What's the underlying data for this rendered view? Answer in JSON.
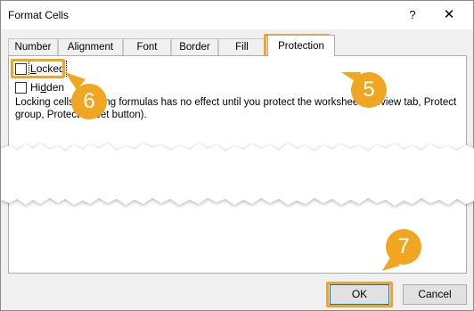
{
  "window": {
    "title": "Format Cells",
    "help_glyph": "?",
    "close_glyph": "✕"
  },
  "tabs": [
    {
      "label": "Number"
    },
    {
      "label": "Alignment"
    },
    {
      "label": "Font"
    },
    {
      "label": "Border"
    },
    {
      "label": "Fill"
    },
    {
      "label": "Protection",
      "selected": true
    }
  ],
  "protection": {
    "locked": {
      "label_first": "L",
      "label_rest": "ocked",
      "checked": false
    },
    "hidden": {
      "label_first": "H",
      "label_mid": "i",
      "label_u": "d",
      "label_rest": "den",
      "checked": false
    },
    "info_text": "Locking cells or hiding formulas has no effect until you protect the worksheet (Review tab, Protect group, Protect Sheet button)."
  },
  "callouts": [
    {
      "number": "5"
    },
    {
      "number": "6"
    },
    {
      "number": "7"
    }
  ],
  "buttons": {
    "ok": "OK",
    "cancel": "Cancel"
  },
  "colors": {
    "accent": "#f0a620",
    "dialog_bg": "#f0f0f0",
    "default_button_border": "#0078d7"
  }
}
